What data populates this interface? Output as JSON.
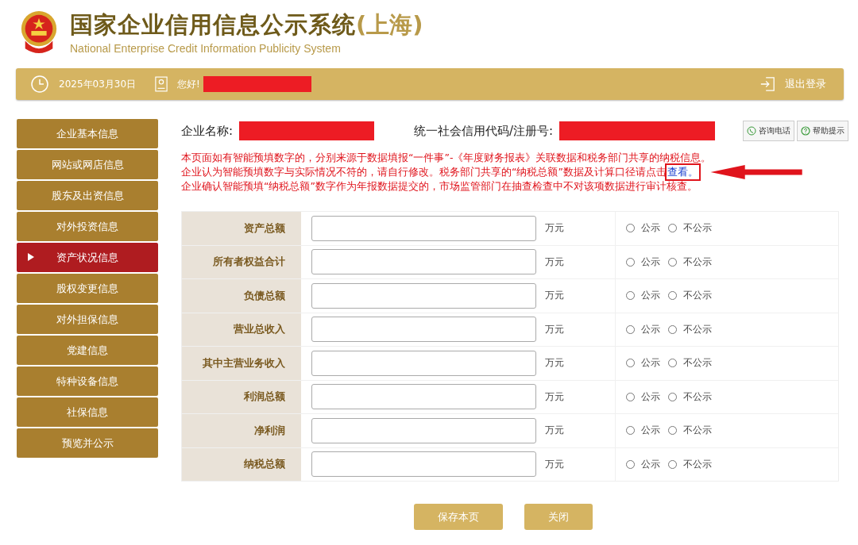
{
  "header": {
    "title": "国家企业信用信息公示系统",
    "region": "(上海)",
    "subtitle": "National Enterprise Credit Information Publicity System"
  },
  "top_bar": {
    "date": "2025年03月30日",
    "greeting": "您好!",
    "user_redacted": true,
    "logout": "退出登录"
  },
  "sidebar": {
    "items": [
      {
        "label": "企业基本信息",
        "selected": false
      },
      {
        "label": "网站或网店信息",
        "selected": false
      },
      {
        "label": "股东及出资信息",
        "selected": false
      },
      {
        "label": "对外投资信息",
        "selected": false
      },
      {
        "label": "资产状况信息",
        "selected": true
      },
      {
        "label": "股权变更信息",
        "selected": false
      },
      {
        "label": "对外担保信息",
        "selected": false
      },
      {
        "label": "党建信息",
        "selected": false
      },
      {
        "label": "特种设备信息",
        "selected": false
      },
      {
        "label": "社保信息",
        "selected": false
      },
      {
        "label": "预览并公示",
        "selected": false
      }
    ]
  },
  "company": {
    "name_label": "企业名称:",
    "name_redacted": true,
    "code_label": "统一社会信用代码/注册号:",
    "code_redacted": true
  },
  "tools": [
    {
      "label": "咨询电话",
      "kind": "phone"
    },
    {
      "label": "帮助提示",
      "kind": "help"
    }
  ],
  "notice": [
    {
      "text": "本页面如有智能预填数字的，分别来源于数据填报“一件事”-《年度财务报表》关联数据和税务部门共享的纳税信息。"
    },
    {
      "text": "企业认为智能预填数字与实际情况不符的，请自行修改。税务部门共享的“纳税总额”数据及计算口径请点击",
      "link": "查看。",
      "highlighted": true
    },
    {
      "text": "企业确认智能预填“纳税总额”数字作为年报数据提交的，市场监管部门在抽查检查中不对该项数据进行审计核查。"
    }
  ],
  "table": {
    "rows": [
      {
        "label": "资产总额",
        "unit": "万元",
        "options": [
          {
            "label": "公示",
            "selected": false
          },
          {
            "label": "不公示",
            "selected": false
          }
        ]
      },
      {
        "label": "所有者权益合计",
        "unit": "万元",
        "options": [
          {
            "label": "公示",
            "selected": false
          },
          {
            "label": "不公示",
            "selected": false
          }
        ]
      },
      {
        "label": "负债总额",
        "unit": "万元",
        "options": [
          {
            "label": "公示",
            "selected": false
          },
          {
            "label": "不公示",
            "selected": false
          }
        ]
      },
      {
        "label": "营业总收入",
        "unit": "万元",
        "options": [
          {
            "label": "公示",
            "selected": false
          },
          {
            "label": "不公示",
            "selected": false
          }
        ]
      },
      {
        "label": "其中主营业务收入",
        "unit": "万元",
        "options": [
          {
            "label": "公示",
            "selected": false
          },
          {
            "label": "不公示",
            "selected": false
          }
        ]
      },
      {
        "label": "利润总额",
        "unit": "万元",
        "options": [
          {
            "label": "公示",
            "selected": false
          },
          {
            "label": "不公示",
            "selected": false
          }
        ]
      },
      {
        "label": "净利润",
        "unit": "万元",
        "options": [
          {
            "label": "公示",
            "selected": false
          },
          {
            "label": "不公示",
            "selected": false
          }
        ]
      },
      {
        "label": "纳税总额",
        "unit": "万元",
        "options": [
          {
            "label": "公示",
            "selected": false
          },
          {
            "label": "不公示",
            "selected": false
          }
        ]
      }
    ]
  },
  "buttons": [
    {
      "label": "保存本页"
    },
    {
      "label": "关闭"
    }
  ]
}
